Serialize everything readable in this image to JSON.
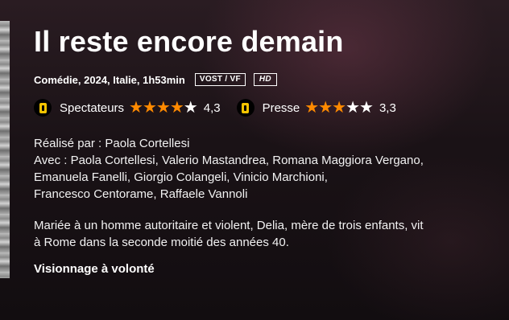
{
  "movie": {
    "title": "Il reste encore demain",
    "meta": "Comédie, 2024, Italie, 1h53min",
    "badges": {
      "language": "VOST / VF",
      "quality": "HD"
    }
  },
  "ratings": [
    {
      "label": "Spectateurs",
      "score_text": "4,3",
      "score": 4.3,
      "icon": "allocine-ticket-icon"
    },
    {
      "label": "Presse",
      "score_text": "3,3",
      "score": 3.3,
      "icon": "allocine-ticket-icon"
    }
  ],
  "credits": {
    "director_line": "Réalisé par : Paola Cortellesi",
    "cast_lines": [
      "Avec : Paola Cortellesi, Valerio Mastandrea, Romana Maggiora Vergano,",
      "Emanuela Fanelli, Giorgio Colangeli, Vinicio Marchioni,",
      "Francesco Centorame, Raffaele Vannoli"
    ]
  },
  "synopsis_lines": [
    "Mariée à un homme autoritaire et violent, Delia, mère de trois enfants, vit",
    "à Rome dans la seconde moitié des années 40."
  ],
  "availability": "Visionnage à volonté",
  "colors": {
    "star_filled": "#ff8a00",
    "star_empty": "#ffffff",
    "ticket": "#f5c400"
  }
}
